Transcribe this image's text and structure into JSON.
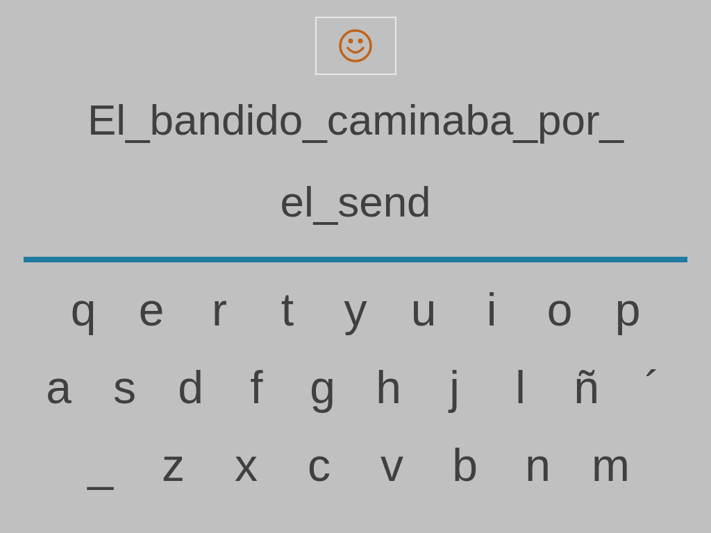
{
  "phrase": [
    "El_bandido_caminaba_por_",
    "el_send"
  ],
  "keyboard": {
    "rows": [
      [
        "q",
        "e",
        "r",
        "t",
        "y",
        "u",
        "i",
        "o",
        "p"
      ],
      [
        "a",
        "s",
        "d",
        "f",
        "g",
        "h",
        "j",
        "l",
        "ñ",
        "´"
      ],
      [
        "_",
        "z",
        "x",
        "c",
        "v",
        "b",
        "n",
        "m"
      ]
    ]
  }
}
